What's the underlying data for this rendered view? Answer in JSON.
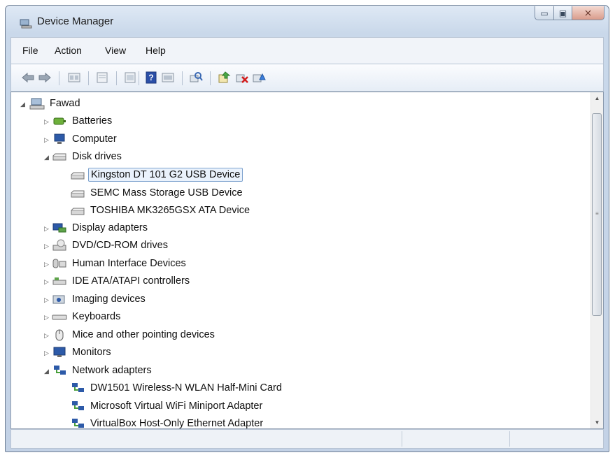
{
  "window": {
    "title": "Device Manager",
    "controls": {
      "minimize": "▭",
      "maximize": "▣",
      "close": "⨯"
    }
  },
  "menu": [
    "File",
    "Action",
    "View",
    "Help"
  ],
  "toolbar": {
    "icons": [
      "back-arrow-icon",
      "forward-arrow-icon",
      "properties-icon",
      "view-icon",
      "help-icon",
      "console-icon",
      "scan-hardware-icon",
      "update-driver-icon",
      "uninstall-icon",
      "enable-device-icon"
    ]
  },
  "tree": {
    "root": "Fawad",
    "items": [
      {
        "label": "Batteries",
        "state": "collapsed",
        "icon": "battery-icon"
      },
      {
        "label": "Computer",
        "state": "collapsed",
        "icon": "computer-icon"
      },
      {
        "label": "Disk drives",
        "state": "expanded",
        "icon": "disk-drive-icon"
      },
      {
        "label": "Kingston DT 101 G2 USB Device",
        "child": true,
        "selected": true,
        "icon": "disk-drive-icon"
      },
      {
        "label": "SEMC Mass Storage USB Device",
        "child": true,
        "icon": "disk-drive-icon"
      },
      {
        "label": "TOSHIBA MK3265GSX ATA Device",
        "child": true,
        "icon": "disk-drive-icon"
      },
      {
        "label": "Display adapters",
        "state": "collapsed",
        "icon": "display-adapter-icon"
      },
      {
        "label": "DVD/CD-ROM drives",
        "state": "collapsed",
        "icon": "dvd-drive-icon"
      },
      {
        "label": "Human Interface Devices",
        "state": "collapsed",
        "icon": "hid-icon"
      },
      {
        "label": "IDE ATA/ATAPI controllers",
        "state": "collapsed",
        "icon": "ide-controller-icon"
      },
      {
        "label": "Imaging devices",
        "state": "collapsed",
        "icon": "imaging-icon"
      },
      {
        "label": "Keyboards",
        "state": "collapsed",
        "icon": "keyboard-icon"
      },
      {
        "label": "Mice and other pointing devices",
        "state": "collapsed",
        "icon": "mouse-icon"
      },
      {
        "label": "Monitors",
        "state": "collapsed",
        "icon": "monitor-icon"
      },
      {
        "label": "Network adapters",
        "state": "expanded",
        "icon": "network-icon"
      },
      {
        "label": "DW1501 Wireless-N WLAN Half-Mini Card",
        "child": true,
        "icon": "network-icon"
      },
      {
        "label": "Microsoft Virtual WiFi Miniport Adapter",
        "child": true,
        "icon": "network-icon"
      },
      {
        "label": "VirtualBox Host-Only Ethernet Adapter",
        "child": true,
        "icon": "network-icon"
      }
    ]
  },
  "colors": {
    "title_bar": "#c9d8ea",
    "selection": "#eaf2fc",
    "selection_border": "#7da2ce"
  }
}
